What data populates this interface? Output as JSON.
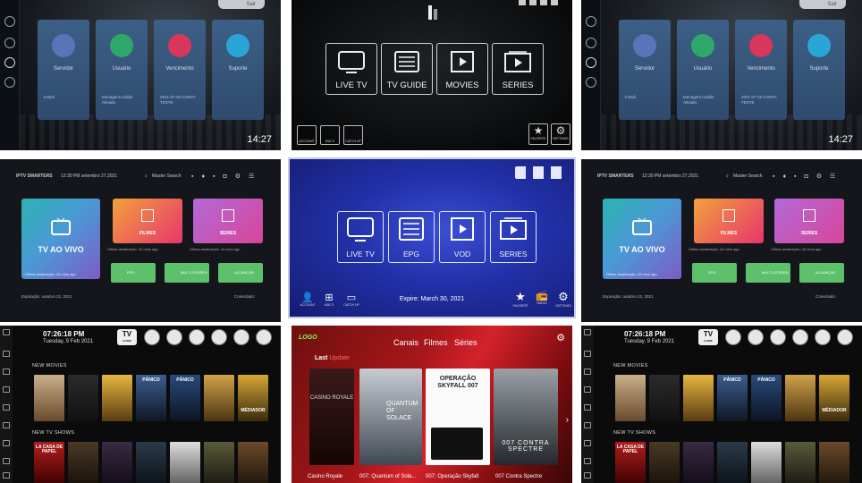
{
  "account_panel": {
    "top_pill": "Sair",
    "clock": "14:27",
    "cards": [
      {
        "label": "Servidor",
        "detail": "Install",
        "color": "#5b73b8"
      },
      {
        "label": "Usuário",
        "detail": "teenagers.mobile Ativado",
        "color": "#2ea86a"
      },
      {
        "label": "Vencimento",
        "detail": "2021-07-25 CONTA TESTE",
        "color": "#d8365a"
      },
      {
        "label": "Suporte",
        "detail": "",
        "color": "#2aa6d6"
      }
    ]
  },
  "dark_menu": {
    "tiles": [
      "LIVE TV",
      "TV GUIDE",
      "MOVIES",
      "SERIES"
    ],
    "bottom_left": [
      "ACCOUNT",
      "MULTI",
      "CATCH UP"
    ],
    "bottom_right": [
      "FAVORITE",
      "SETTINGS"
    ]
  },
  "smarters": {
    "brand": "IPTV SMARTERS",
    "datetime": "12:30 PM setembro 27,2021",
    "search": "Master Search",
    "tiles": {
      "live": "TV AO VIVO",
      "movies": "FILMES",
      "series": "SERIES"
    },
    "updates": {
      "live": "Última atualização: 43 mins ago",
      "movies": "Última atualização: 43 mins ago",
      "series": "Última atualização: 43 secs ago"
    },
    "buttons": [
      "EPG",
      "MULTI-SCREEN",
      "ALCANÇAR"
    ],
    "expiry": "Expiração: outubro 22, 2021",
    "connected": "Conectado:"
  },
  "blue_menu": {
    "tiles": [
      "LIVE TV",
      "EPG",
      "VOD",
      "SERIES"
    ],
    "expire": "Expire: March 30, 2021",
    "bottom_left": [
      "ACCOUNT",
      "MULTI",
      "CATCH UP"
    ],
    "bottom_right": [
      "FAVORITE",
      "RADIO",
      "SETTINGS"
    ]
  },
  "tv_home": {
    "time": "07:26:18 PM",
    "date": "Tuesday, 9 Feb 2021",
    "tv_guide": "TV",
    "tv_guide_sub": "GUIDE",
    "section_movies": "NEW MOVIES",
    "section_shows": "NEW TV SHOWS",
    "posters": [
      "",
      "",
      "",
      "PÂNICO",
      "PÂNICO",
      "",
      "MÉDIADOR",
      ""
    ],
    "show_posters": [
      "LA CASA DE PAPEL",
      "",
      "",
      "",
      "",
      "",
      "",
      ""
    ]
  },
  "bond": {
    "logo": "LOGO",
    "nav": [
      "Canais",
      "Filmes",
      "Séries"
    ],
    "last": "Last",
    "update": "Update",
    "movies": [
      {
        "poster": "CASINO ROYALE",
        "caption": "Casino Royale"
      },
      {
        "poster": "QUANTUM OF SOLACE",
        "caption": "007: Quantum of Sola..."
      },
      {
        "poster": "OPERAÇÃO SKYFALL 007",
        "caption": "007: Operação Skyfall"
      },
      {
        "poster": "007 CONTRA SPECTRE",
        "caption": "007 Contra Spectre"
      }
    ]
  }
}
